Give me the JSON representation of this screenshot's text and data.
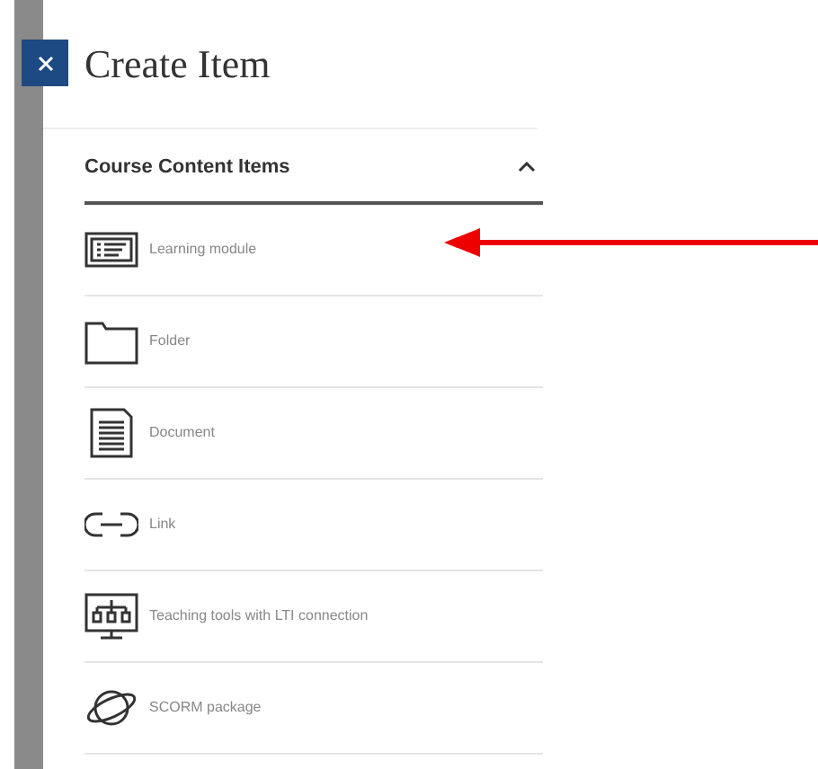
{
  "panel": {
    "title": "Create Item"
  },
  "section": {
    "title": "Course Content Items",
    "expanded": true
  },
  "items": [
    {
      "kind": "module",
      "label": "Learning module"
    },
    {
      "kind": "folder",
      "label": "Folder"
    },
    {
      "kind": "document",
      "label": "Document"
    },
    {
      "kind": "link",
      "label": "Link"
    },
    {
      "kind": "lti",
      "label": "Teaching tools with LTI connection"
    },
    {
      "kind": "scorm",
      "label": "SCORM package"
    }
  ]
}
